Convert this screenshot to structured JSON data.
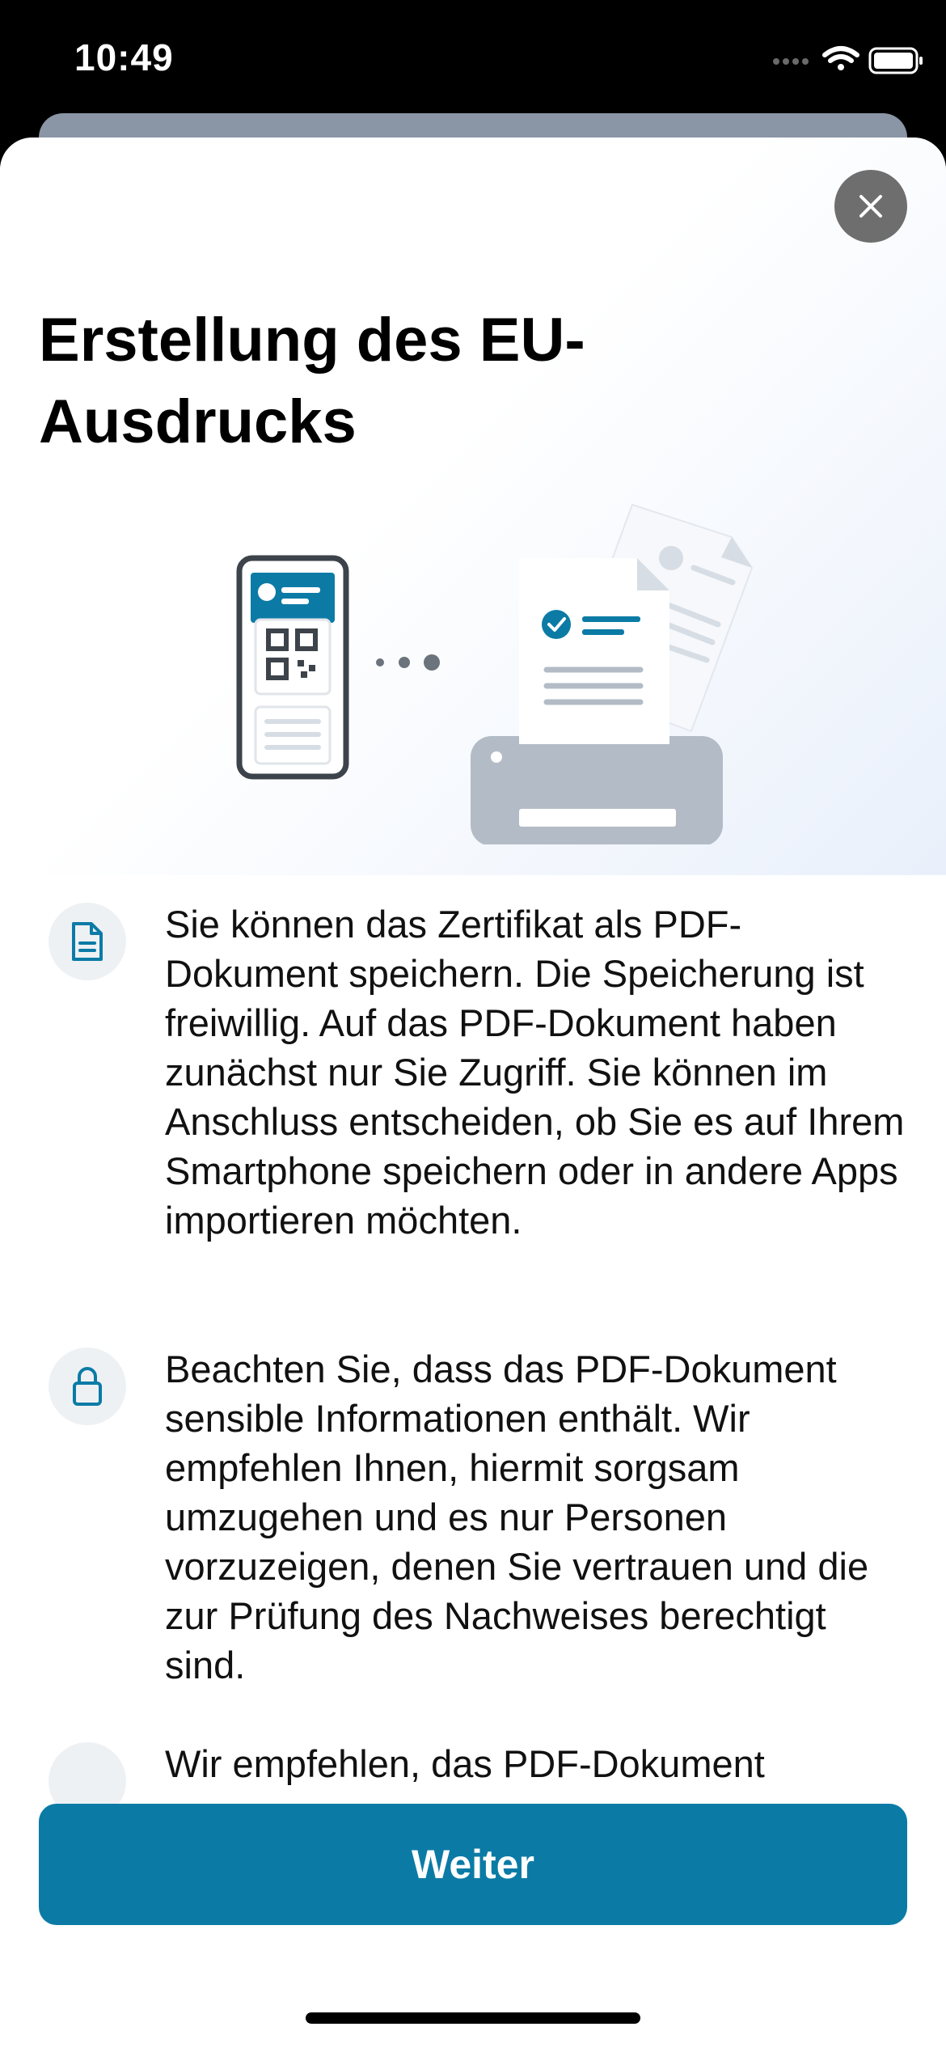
{
  "status_bar": {
    "time": "10:49"
  },
  "sheet": {
    "title": "Erstellung des EU-Ausdrucks",
    "close_icon": "close-icon",
    "info_items": [
      {
        "icon": "document-icon",
        "text": "Sie können das Zertifikat als PDF-Dokument speichern. Die Speicherung ist freiwillig. Auf das PDF-Dokument haben zunächst nur Sie Zugriff. Sie können im Anschluss entscheiden, ob Sie es auf Ihrem Smartphone speichern oder in andere Apps importieren möchten."
      },
      {
        "icon": "lock-icon",
        "text": "Beachten Sie, dass das PDF-Dokument sensible Informationen enthält. Wir empfehlen Ihnen, hiermit sorgsam umzugehen und es nur Personen vorzuzeigen, denen Sie vertrauen und die zur Prüfung des Nachweises berechtigt sind."
      },
      {
        "icon": "info-icon",
        "text": "Wir empfehlen, das PDF-Dokument"
      }
    ],
    "primary_button_label": "Weiter"
  },
  "colors": {
    "accent": "#0b7ba6",
    "close_button": "#6e6e6e",
    "printer": "#b3bcc6",
    "icon_background": "#eef1f4"
  }
}
